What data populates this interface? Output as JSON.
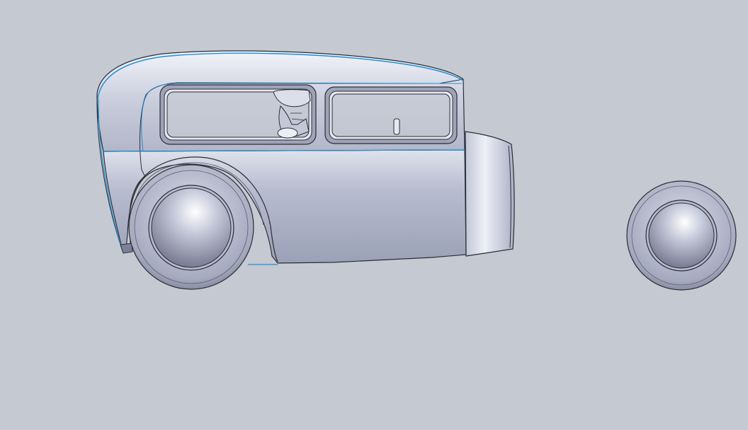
{
  "viewport": {
    "background_color": "#c4c9d2",
    "model_color": "#a9afc4",
    "highlight_color": "#e9ecf5",
    "shadow_color": "#7c8196",
    "edge_color": "#2b2d36",
    "selection_edge_color": "#1f8fd6"
  },
  "model": {
    "parts": [
      {
        "name": "car-body"
      },
      {
        "name": "rear-wheel"
      },
      {
        "name": "front-wheel"
      },
      {
        "name": "driver-figure"
      },
      {
        "name": "steering-column"
      }
    ]
  }
}
